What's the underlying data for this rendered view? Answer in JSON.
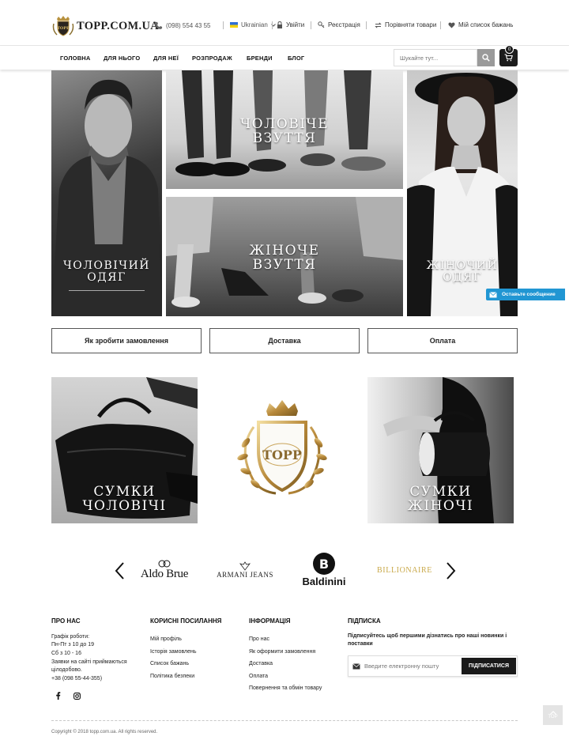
{
  "header": {
    "logo_text": "TOPP.COM.UA",
    "logo_crest_text": "TOPP",
    "phone": "(098) 554 43 55",
    "language": "Ukrainian",
    "login": "Увійти",
    "register": "Реєстрація",
    "compare": "Порівняти товари",
    "wishlist": "Мій список бажань"
  },
  "nav": {
    "items": [
      "Головна",
      "Для нього",
      "Для неї",
      "Розпродаж",
      "Бренди",
      "Блог"
    ],
    "search_placeholder": "Шукайте тут...",
    "cart_count": "0"
  },
  "banners": {
    "mens_clothing": [
      "Чоловічий",
      "одяг"
    ],
    "mens_shoes": [
      "Чоловіче",
      "взуття"
    ],
    "womens_shoes": [
      "Жіноче",
      "взуття"
    ],
    "womens_clothing": [
      "Жіночий",
      "одяг"
    ]
  },
  "info_buttons": [
    "Як зробити замовлення",
    "Доставка",
    "Оплата"
  ],
  "bags": {
    "mens": [
      "Сумки",
      "чоловічі"
    ],
    "womens": [
      "Сумки",
      "жіночі"
    ],
    "center_logo_text": "TOPP"
  },
  "brands": [
    "Aldo Brue",
    "ARMANI JEANS",
    "Baldinini",
    "BILLIONAIRE"
  ],
  "footer": {
    "about": {
      "title": "Про нас",
      "lines": [
        "Графік роботи:",
        "Пн-Пт з 10 до 19",
        "Сб з 10 - 16",
        "Заявки на сайті приймаються",
        "цілодобово.",
        "+38 (098 55-44-355)"
      ]
    },
    "useful": {
      "title": "Корисні посилання",
      "links": [
        "Мій профіль",
        "Історія замовлень",
        "Список бажань",
        "Політика безпеки"
      ]
    },
    "info": {
      "title": "Інформація",
      "links": [
        "Про нас",
        "Як оформити замовлення",
        "Доставка",
        "Оплата",
        "Повернення та обмін товару"
      ]
    },
    "subscribe": {
      "title": "Підписка",
      "description": "Підписуйтесь щоб першими дізнатись про наші новинки і поставки",
      "placeholder": "Введите електронну пошту",
      "button": "Підписатися"
    },
    "copyright": "Copyright © 2018 topp.com.ua. All rights reserved."
  },
  "widgets": {
    "message": "Оставьте сообщение",
    "to_top": "TOP"
  }
}
